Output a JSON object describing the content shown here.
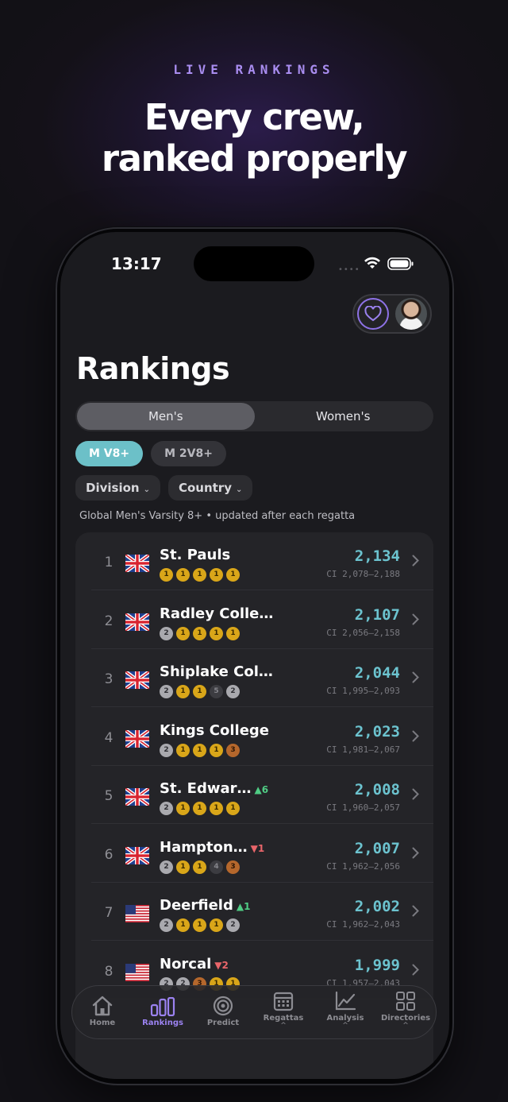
{
  "promo": {
    "kicker": "LIVE RANKINGS",
    "title_line1": "Every crew,",
    "title_line2": "ranked properly"
  },
  "status_bar": {
    "time": "13:17"
  },
  "page": {
    "title": "Rankings",
    "segments": [
      "Men's",
      "Women's"
    ],
    "active_segment": "Men's",
    "chips": [
      "M V8+",
      "M 2V8+"
    ],
    "active_chip": "M V8+",
    "filters": [
      "Division",
      "Country"
    ],
    "subtitle": "Global Men's Varsity 8+ • updated after each regatta"
  },
  "rankings": [
    {
      "rank": "1",
      "flag": "uk",
      "name": "St. Pauls",
      "move": "",
      "move_dir": "",
      "score": "2,134",
      "ci": "CI 2,078–2,188",
      "medals": [
        {
          "v": "1",
          "k": "gold"
        },
        {
          "v": "1",
          "k": "gold"
        },
        {
          "v": "1",
          "k": "gold"
        },
        {
          "v": "1",
          "k": "gold"
        },
        {
          "v": "1",
          "k": "gold"
        }
      ]
    },
    {
      "rank": "2",
      "flag": "uk",
      "name": "Radley Colle…",
      "move": "",
      "move_dir": "",
      "score": "2,107",
      "ci": "CI 2,056–2,158",
      "medals": [
        {
          "v": "2",
          "k": "silver"
        },
        {
          "v": "1",
          "k": "gold"
        },
        {
          "v": "1",
          "k": "gold"
        },
        {
          "v": "1",
          "k": "gold"
        },
        {
          "v": "1",
          "k": "gold"
        }
      ]
    },
    {
      "rank": "3",
      "flag": "uk",
      "name": "Shiplake Col…",
      "move": "",
      "move_dir": "",
      "score": "2,044",
      "ci": "CI 1,995–2,093",
      "medals": [
        {
          "v": "2",
          "k": "silver"
        },
        {
          "v": "1",
          "k": "gold"
        },
        {
          "v": "1",
          "k": "gold"
        },
        {
          "v": "5",
          "k": "none"
        },
        {
          "v": "2",
          "k": "silver"
        }
      ]
    },
    {
      "rank": "4",
      "flag": "uk",
      "name": "Kings College",
      "move": "",
      "move_dir": "",
      "score": "2,023",
      "ci": "CI 1,981–2,067",
      "medals": [
        {
          "v": "2",
          "k": "silver"
        },
        {
          "v": "1",
          "k": "gold"
        },
        {
          "v": "1",
          "k": "gold"
        },
        {
          "v": "1",
          "k": "gold"
        },
        {
          "v": "3",
          "k": "bronze"
        }
      ]
    },
    {
      "rank": "5",
      "flag": "uk",
      "name": "St. Edwar…",
      "move": "▲6",
      "move_dir": "up",
      "score": "2,008",
      "ci": "CI 1,960–2,057",
      "medals": [
        {
          "v": "2",
          "k": "silver"
        },
        {
          "v": "1",
          "k": "gold"
        },
        {
          "v": "1",
          "k": "gold"
        },
        {
          "v": "1",
          "k": "gold"
        },
        {
          "v": "1",
          "k": "gold"
        }
      ]
    },
    {
      "rank": "6",
      "flag": "uk",
      "name": "Hampton…",
      "move": "▼1",
      "move_dir": "down",
      "score": "2,007",
      "ci": "CI 1,962–2,056",
      "medals": [
        {
          "v": "2",
          "k": "silver"
        },
        {
          "v": "1",
          "k": "gold"
        },
        {
          "v": "1",
          "k": "gold"
        },
        {
          "v": "4",
          "k": "none"
        },
        {
          "v": "3",
          "k": "bronze"
        }
      ]
    },
    {
      "rank": "7",
      "flag": "us",
      "name": "Deerfield",
      "move": "▲1",
      "move_dir": "up",
      "score": "2,002",
      "ci": "CI 1,962–2,043",
      "medals": [
        {
          "v": "2",
          "k": "silver"
        },
        {
          "v": "1",
          "k": "gold"
        },
        {
          "v": "1",
          "k": "gold"
        },
        {
          "v": "1",
          "k": "gold"
        },
        {
          "v": "2",
          "k": "silver"
        }
      ]
    },
    {
      "rank": "8",
      "flag": "us",
      "name": "Norcal",
      "move": "▼2",
      "move_dir": "down",
      "score": "1,999",
      "ci": "CI 1,957–2,043",
      "medals": [
        {
          "v": "2",
          "k": "silver"
        },
        {
          "v": "2",
          "k": "silver"
        },
        {
          "v": "3",
          "k": "bronze"
        },
        {
          "v": "1",
          "k": "gold"
        },
        {
          "v": "1",
          "k": "gold"
        }
      ]
    }
  ],
  "tabbar": {
    "items": [
      {
        "label": "Home",
        "icon": "home-icon"
      },
      {
        "label": "Rankings",
        "icon": "bar-chart-icon"
      },
      {
        "label": "Predict",
        "icon": "target-icon"
      },
      {
        "label": "Regattas",
        "icon": "calendar-icon"
      },
      {
        "label": "Analysis",
        "icon": "line-chart-icon"
      },
      {
        "label": "Directories",
        "icon": "grid-icon"
      }
    ],
    "active": "Rankings"
  },
  "colors": {
    "accent_purple": "#9b82f0",
    "score_teal": "#6cc3cf",
    "chip_active": "#6cc0c8",
    "move_up": "#4fcc84",
    "move_down": "#e9656a"
  }
}
